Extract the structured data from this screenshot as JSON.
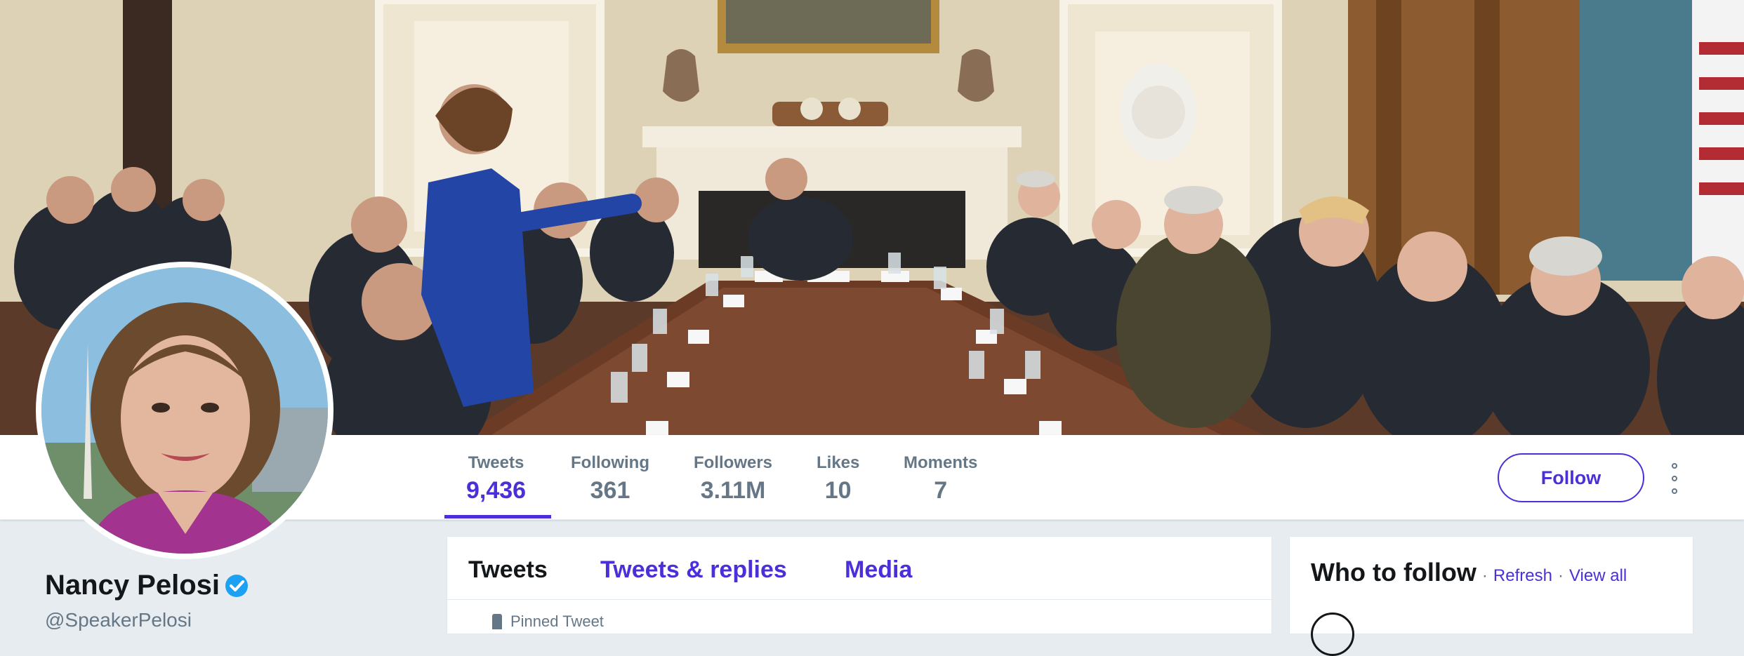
{
  "profile": {
    "name": "Nancy Pelosi",
    "handle_partial": "@SpeakerPelosi",
    "verified": true
  },
  "stats": [
    {
      "label": "Tweets",
      "value": "9,436",
      "active": true
    },
    {
      "label": "Following",
      "value": "361",
      "active": false
    },
    {
      "label": "Followers",
      "value": "3.11M",
      "active": false
    },
    {
      "label": "Likes",
      "value": "10",
      "active": false
    },
    {
      "label": "Moments",
      "value": "7",
      "active": false
    }
  ],
  "actions": {
    "follow_label": "Follow",
    "more_icon": "more-vertical-icon"
  },
  "timeline": {
    "tabs": [
      {
        "label": "Tweets",
        "active": true
      },
      {
        "label": "Tweets & replies",
        "active": false
      },
      {
        "label": "Media",
        "active": false
      }
    ],
    "pinned_label": "Pinned Tweet"
  },
  "who_to_follow": {
    "title": "Who to follow",
    "separator": "·",
    "refresh_label": "Refresh",
    "view_all_label": "View all"
  },
  "colors": {
    "accent": "#4c2fd8",
    "background": "#e6ecf0",
    "muted_text": "#657786",
    "primary_text": "#14171a",
    "verified": "#1da1f2"
  }
}
